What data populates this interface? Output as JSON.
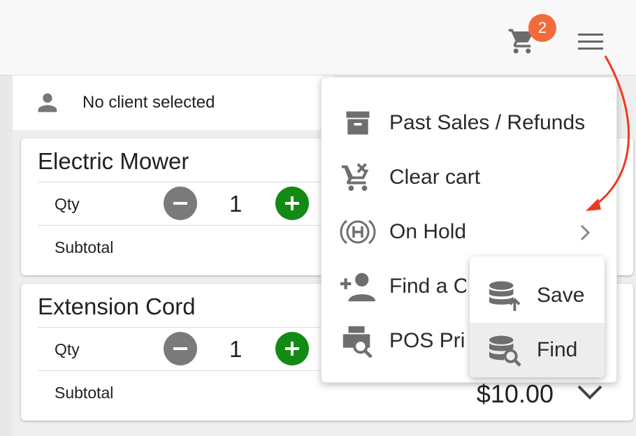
{
  "header": {
    "cart_count": "2",
    "badge_color": "#f26b3a"
  },
  "client": {
    "label": "No client selected"
  },
  "cart_items": [
    {
      "name": "Electric Mower",
      "qty_label": "Qty",
      "qty": "1",
      "subtotal_label": "Subtotal",
      "subtotal": ""
    },
    {
      "name": "Extension Cord",
      "qty_label": "Qty",
      "qty": "1",
      "subtotal_label": "Subtotal",
      "subtotal": "$10.00"
    }
  ],
  "menu": {
    "items": [
      {
        "label": "Past Sales / Refunds",
        "icon": "archive-icon"
      },
      {
        "label": "Clear cart",
        "icon": "clear-cart-icon"
      },
      {
        "label": "On Hold",
        "icon": "hold-icon"
      },
      {
        "label": "Find a Customer",
        "icon": "add-person-icon"
      },
      {
        "label": "POS Printer",
        "icon": "printer-search-icon"
      }
    ]
  },
  "submenu": {
    "items": [
      {
        "label": "Save",
        "icon": "database-upload-icon"
      },
      {
        "label": "Find",
        "icon": "database-search-icon"
      }
    ]
  },
  "colors": {
    "plus_button": "#138a13",
    "minus_button": "#7a7a7a",
    "annotation_arrow": "#f0381f"
  }
}
